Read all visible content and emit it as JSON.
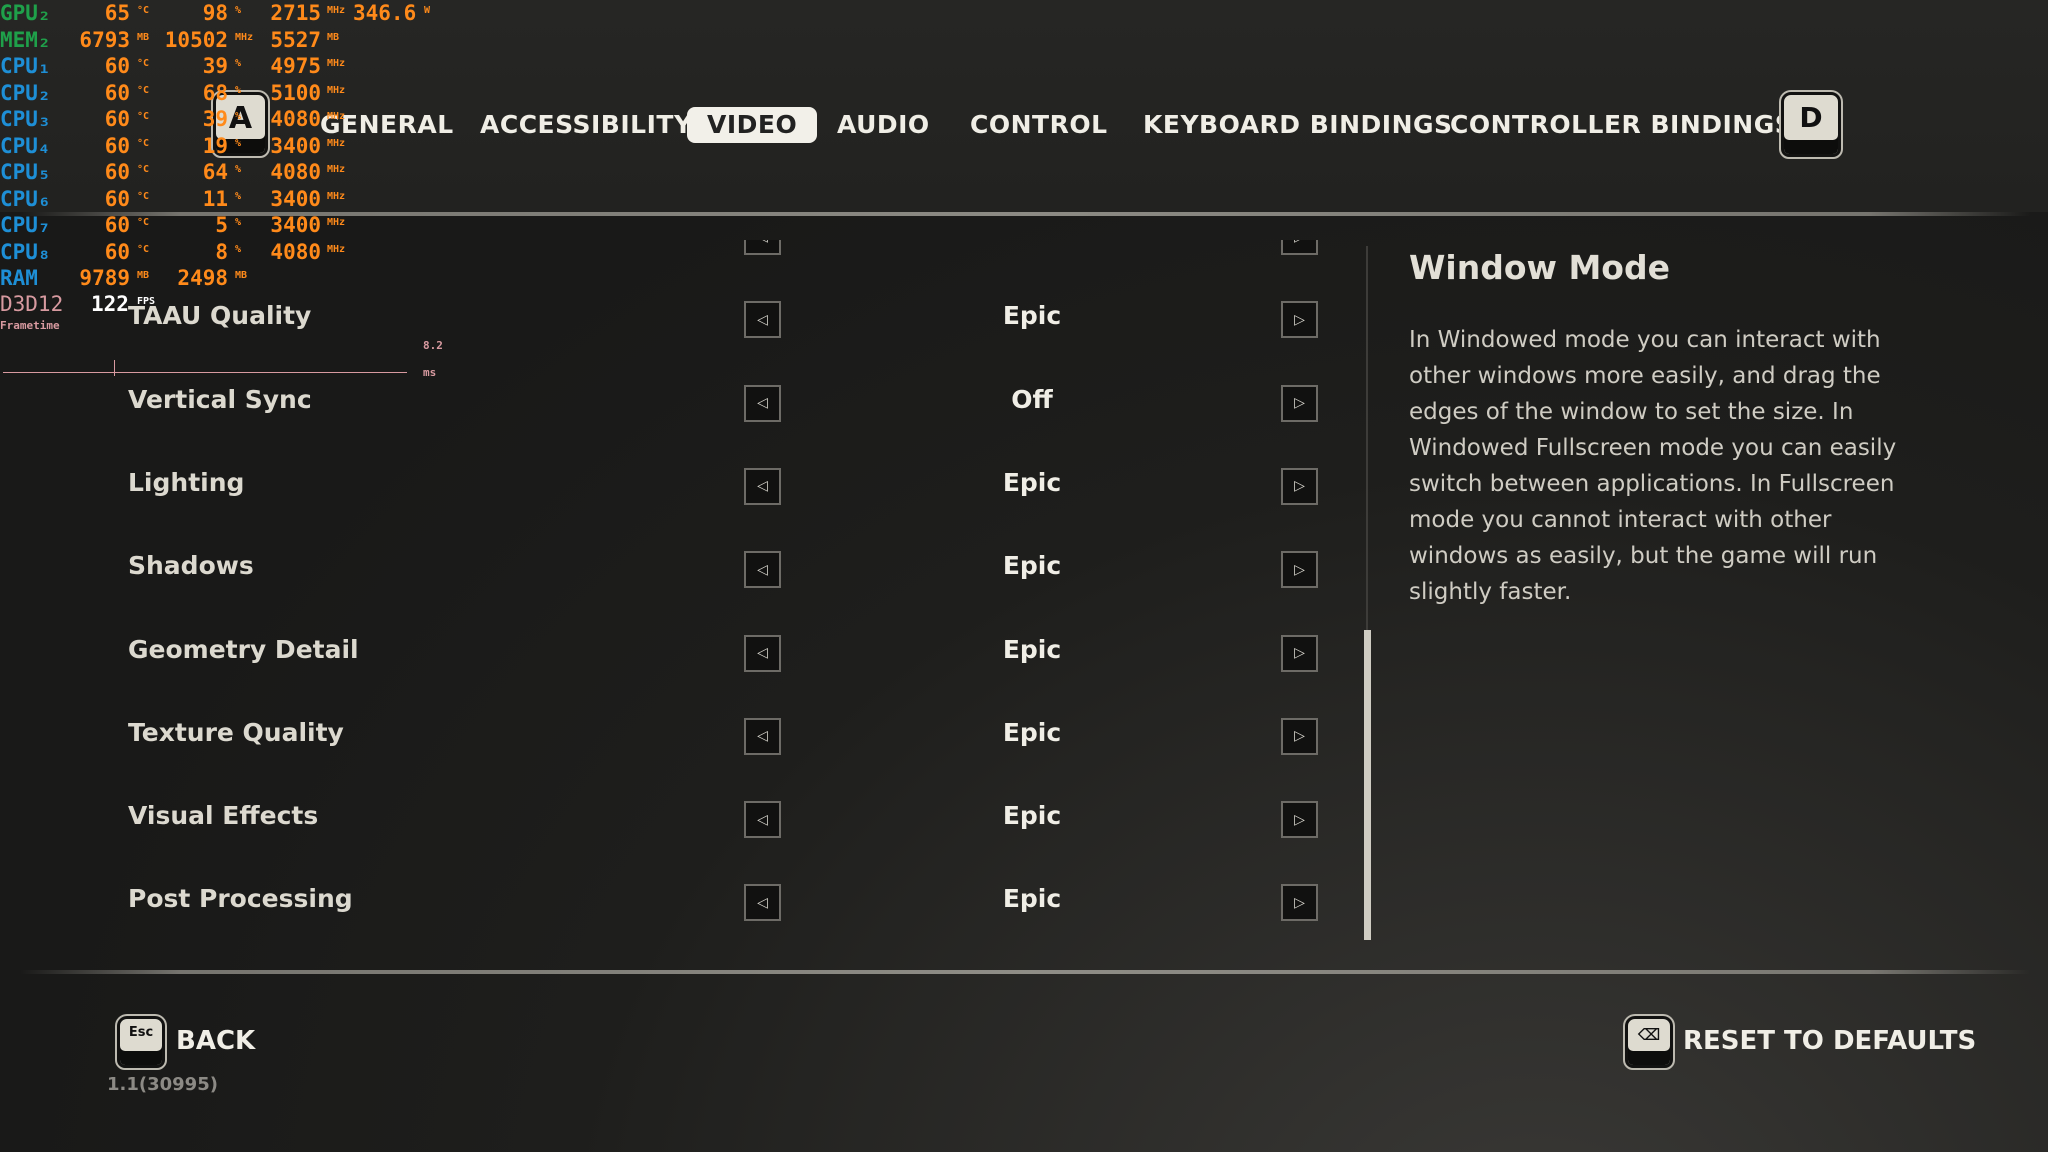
{
  "tabs": {
    "prev_key": "A",
    "next_key": "D",
    "items": [
      {
        "label": "GENERAL",
        "active": false
      },
      {
        "label": "ACCESSIBILITY",
        "active": false
      },
      {
        "label": "VIDEO",
        "active": true
      },
      {
        "label": "AUDIO",
        "active": false
      },
      {
        "label": "CONTROL",
        "active": false
      },
      {
        "label": "KEYBOARD BINDINGS",
        "active": false
      },
      {
        "label": "CONTROLLER BINDINGS",
        "active": false
      }
    ]
  },
  "settings": [
    {
      "label": "",
      "value": ""
    },
    {
      "label": "TAAU Quality",
      "value": "Epic"
    },
    {
      "label": "Vertical Sync",
      "value": "Off"
    },
    {
      "label": "Lighting",
      "value": "Epic"
    },
    {
      "label": "Shadows",
      "value": "Epic"
    },
    {
      "label": "Geometry Detail",
      "value": "Epic"
    },
    {
      "label": "Texture Quality",
      "value": "Epic"
    },
    {
      "label": "Visual Effects",
      "value": "Epic"
    },
    {
      "label": "Post Processing",
      "value": "Epic"
    }
  ],
  "arrows": {
    "left": "◁",
    "right": "▷"
  },
  "help": {
    "title": "Window Mode",
    "body": "In Windowed mode you can interact with other windows more easily, and drag the edges of the window to set the size. In Windowed Fullscreen mode you can easily switch between applications. In Fullscreen mode you cannot interact with other windows as easily, but the game will run slightly faster."
  },
  "footer": {
    "back_key": "Esc",
    "back_label": "BACK",
    "reset_label": "RESET TO DEFAULTS",
    "version": "1.1(30995)"
  },
  "overlay": {
    "colors": {
      "gpu": "#1fa04a",
      "cpu": "#1e8fd6",
      "value": "#ff8a1a",
      "api": "#d89aa0"
    },
    "rows": [
      {
        "name": "GPU₂",
        "kind": "gpu",
        "v": [
          "65",
          "98",
          "2715",
          "346.6"
        ],
        "u": [
          "°C",
          "%",
          "MHz",
          "W"
        ]
      },
      {
        "name": "MEM₂",
        "kind": "gpu",
        "v": [
          "6793",
          "10502",
          "5527"
        ],
        "u": [
          "MB",
          "MHz",
          "MB"
        ]
      },
      {
        "name": "CPU₁",
        "kind": "cpu",
        "v": [
          "60",
          "39",
          "4975"
        ],
        "u": [
          "°C",
          "%",
          "MHz"
        ]
      },
      {
        "name": "CPU₂",
        "kind": "cpu",
        "v": [
          "60",
          "68",
          "5100"
        ],
        "u": [
          "°C",
          "%",
          "MHz"
        ]
      },
      {
        "name": "CPU₃",
        "kind": "cpu",
        "v": [
          "60",
          "39",
          "4080"
        ],
        "u": [
          "°C",
          "%",
          "MHz"
        ]
      },
      {
        "name": "CPU₄",
        "kind": "cpu",
        "v": [
          "60",
          "19",
          "3400"
        ],
        "u": [
          "°C",
          "%",
          "MHz"
        ]
      },
      {
        "name": "CPU₅",
        "kind": "cpu",
        "v": [
          "60",
          "64",
          "4080"
        ],
        "u": [
          "°C",
          "%",
          "MHz"
        ]
      },
      {
        "name": "CPU₆",
        "kind": "cpu",
        "v": [
          "60",
          "11",
          "3400"
        ],
        "u": [
          "°C",
          "%",
          "MHz"
        ]
      },
      {
        "name": "CPU₇",
        "kind": "cpu",
        "v": [
          "60",
          "5",
          "3400"
        ],
        "u": [
          "°C",
          "%",
          "MHz"
        ]
      },
      {
        "name": "CPU₈",
        "kind": "cpu",
        "v": [
          "60",
          "8",
          "4080"
        ],
        "u": [
          "°C",
          "%",
          "MHz"
        ]
      },
      {
        "name": "RAM",
        "kind": "cpu",
        "v": [
          "9789",
          "2498"
        ],
        "u": [
          "MB",
          "MB"
        ]
      }
    ],
    "api": "D3D12",
    "fps": "122",
    "fps_unit": "FPS",
    "frametime_label": "Frametime",
    "frametime_value": "8.2 ms"
  }
}
